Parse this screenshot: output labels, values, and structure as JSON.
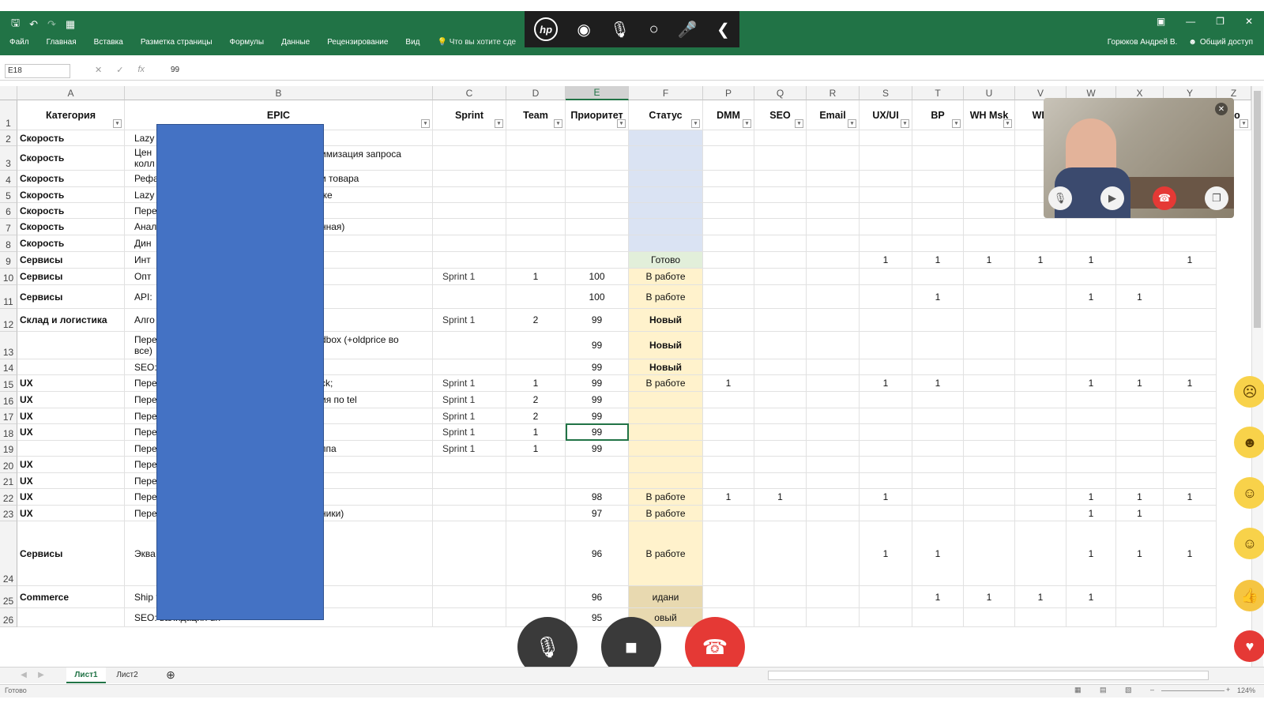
{
  "ribbon": {
    "tabs": [
      "Файл",
      "Главная",
      "Вставка",
      "Разметка страницы",
      "Формулы",
      "Данные",
      "Рецензирование",
      "Вид"
    ],
    "tell_me": "Что вы хотите сде",
    "user": "Горюков Андрей В.",
    "share": "Общий доступ"
  },
  "formula_bar": {
    "name_box": "E18",
    "value": "99"
  },
  "columns": [
    "A",
    "B",
    "C",
    "D",
    "E",
    "F",
    "P",
    "Q",
    "R",
    "S",
    "T",
    "U",
    "V",
    "W",
    "X",
    "Y",
    "Z"
  ],
  "header_row": [
    "Категория",
    "EPIC",
    "Sprint",
    "Team",
    "Приоритет",
    "Статус",
    "DMM",
    "SEO",
    "Email",
    "UX/UI",
    "BP",
    "WH Msk",
    "WH",
    "",
    "",
    "",
    "Co"
  ],
  "rows": [
    {
      "n": "2",
      "cat": "Скорость",
      "epic": "Lazy",
      "epic_right": "",
      "sprint": "",
      "team": "",
      "prio": "",
      "status": "",
      "flags": [
        "",
        "",
        "",
        "",
        "",
        "",
        "",
        "",
        "",
        ""
      ]
    },
    {
      "n": "3",
      "cat": "Скорость",
      "epic": "Цен",
      "epic2": "колл",
      "epic_right": "имизация запроса",
      "sprint": "",
      "team": "",
      "prio": "",
      "status": "",
      "flags": [
        "",
        "",
        "",
        "",
        "",
        "",
        "",
        "",
        "",
        ""
      ]
    },
    {
      "n": "4",
      "cat": "Скорость",
      "epic": "Рефа",
      "epic_right": "и товара",
      "sprint": "",
      "team": "",
      "prio": "",
      "status": "",
      "flags": [
        "",
        "",
        "",
        "",
        "",
        "",
        "",
        "",
        "",
        ""
      ]
    },
    {
      "n": "5",
      "cat": "Скорость",
      "epic": "Lazy",
      "epic_right": "іке",
      "sprint": "",
      "team": "",
      "prio": "",
      "status": "",
      "flags": [
        "",
        "",
        "",
        "",
        "",
        "",
        "",
        "",
        "",
        ""
      ]
    },
    {
      "n": "6",
      "cat": "Скорость",
      "epic": "Пере",
      "epic_right": "",
      "sprint": "",
      "team": "",
      "prio": "",
      "status": "",
      "flags": [
        "",
        "",
        "",
        "",
        "",
        "",
        "",
        "",
        "",
        ""
      ]
    },
    {
      "n": "7",
      "cat": "Скорость",
      "epic": "Анал",
      "epic_right": "нная)",
      "sprint": "",
      "team": "",
      "prio": "",
      "status": "",
      "flags": [
        "",
        "",
        "",
        "",
        "",
        "",
        "",
        "",
        "",
        ""
      ]
    },
    {
      "n": "8",
      "cat": "Скорость",
      "epic": "Дин",
      "epic_right": "",
      "sprint": "",
      "team": "",
      "prio": "",
      "status": "",
      "flags": [
        "",
        "",
        "",
        "",
        "",
        "",
        "",
        "",
        "",
        ""
      ]
    },
    {
      "n": "9",
      "cat": "Сервисы",
      "epic": "Инт",
      "epic_right": "",
      "sprint": "",
      "team": "",
      "prio": "",
      "status": "Готово",
      "flags": [
        "",
        "",
        "",
        "1",
        "1",
        "1",
        "1",
        "1",
        "",
        "1"
      ]
    },
    {
      "n": "10",
      "cat": "Сервисы",
      "epic": "Опт",
      "epic_right": "",
      "sprint": "Sprint 1",
      "team": "1",
      "prio": "100",
      "status": "В работе",
      "flags": [
        "",
        "",
        "",
        "",
        "",
        "",
        "",
        "",
        "",
        ""
      ]
    },
    {
      "n": "11",
      "cat": "Сервисы",
      "epic": "API:",
      "epic_right": "",
      "sprint": "",
      "team": "",
      "prio": "100",
      "status": "В работе",
      "flags": [
        "",
        "",
        "",
        "",
        "1",
        "",
        "",
        "1",
        "1",
        ""
      ]
    },
    {
      "n": "12",
      "cat": "Склад и логистика",
      "epic": "Алго",
      "epic_right": "",
      "sprint": "Sprint 1",
      "team": "2",
      "prio": "99",
      "status": "Новый",
      "flags": [
        "",
        "",
        "",
        "",
        "",
        "",
        "",
        "",
        "",
        ""
      ]
    },
    {
      "n": "13",
      "cat": "",
      "epic": "Пере",
      "epic2": "все)",
      "epic_right": "dbox (+oldprice во",
      "sprint": "",
      "team": "",
      "prio": "99",
      "status": "Новый",
      "flags": [
        "",
        "",
        "",
        "",
        "",
        "",
        "",
        "",
        "",
        ""
      ]
    },
    {
      "n": "14",
      "cat": "",
      "epic": "SEO:",
      "epic_right": "",
      "sprint": "",
      "team": "",
      "prio": "99",
      "status": "Новый",
      "flags": [
        "",
        "",
        "",
        "",
        "",
        "",
        "",
        "",
        "",
        ""
      ]
    },
    {
      "n": "15",
      "cat": "UX",
      "epic": "Пере",
      "epic_right": "ck;",
      "sprint": "Sprint 1",
      "team": "1",
      "prio": "99",
      "status": "В работе",
      "flags": [
        "1",
        "",
        "",
        "1",
        "1",
        "",
        "",
        "1",
        "1",
        "1"
      ]
    },
    {
      "n": "16",
      "cat": "UX",
      "epic": "Пере",
      "epic_right": "ия по tel",
      "sprint": "Sprint 1",
      "team": "2",
      "prio": "99",
      "status": "",
      "flags": [
        "",
        "",
        "",
        "",
        "",
        "",
        "",
        "",
        "",
        ""
      ]
    },
    {
      "n": "17",
      "cat": "UX",
      "epic": "Пере",
      "epic_right": "",
      "sprint": "Sprint 1",
      "team": "2",
      "prio": "99",
      "status": "",
      "flags": [
        "",
        "",
        "",
        "",
        "",
        "",
        "",
        "",
        "",
        ""
      ]
    },
    {
      "n": "18",
      "cat": "UX",
      "epic": "Пере",
      "epic_right": "",
      "sprint": "Sprint 1",
      "team": "1",
      "prio": "99",
      "status": "",
      "flags": [
        "",
        "",
        "",
        "",
        "",
        "",
        "",
        "",
        "",
        ""
      ]
    },
    {
      "n": "19",
      "cat": "",
      "epic": "Пере",
      "epic_right": "ппа",
      "sprint": "Sprint 1",
      "team": "1",
      "prio": "99",
      "status": "",
      "flags": [
        "",
        "",
        "",
        "",
        "",
        "",
        "",
        "",
        "",
        ""
      ]
    },
    {
      "n": "20",
      "cat": "UX",
      "epic": "Пере",
      "epic_right": "",
      "sprint": "",
      "team": "",
      "prio": "",
      "status": "",
      "flags": [
        "",
        "",
        "",
        "",
        "",
        "",
        "",
        "",
        "",
        ""
      ]
    },
    {
      "n": "21",
      "cat": "UX",
      "epic": "Пере",
      "epic_right": "",
      "sprint": "",
      "team": "",
      "prio": "",
      "status": "",
      "flags": [
        "",
        "",
        "",
        "",
        "",
        "",
        "",
        "",
        "",
        ""
      ]
    },
    {
      "n": "22",
      "cat": "UX",
      "epic": "Пере",
      "epic_right": "",
      "sprint": "",
      "team": "",
      "prio": "98",
      "status": "В работе",
      "flags": [
        "1",
        "1",
        "",
        "1",
        "",
        "",
        "",
        "1",
        "1",
        "1"
      ]
    },
    {
      "n": "23",
      "cat": "UX",
      "epic": "Пере",
      "epic_right": "ники)",
      "sprint": "",
      "team": "",
      "prio": "97",
      "status": "В работе",
      "flags": [
        "",
        "",
        "",
        "",
        "",
        "",
        "",
        "1",
        "1",
        ""
      ]
    },
    {
      "n": "24",
      "cat": "Сервисы",
      "epic": "Эква",
      "epic_right": "",
      "sprint": "",
      "team": "",
      "prio": "96",
      "status": "В работе",
      "flags": [
        "",
        "",
        "",
        "1",
        "1",
        "",
        "",
        "1",
        "1",
        "1"
      ]
    },
    {
      "n": "25",
      "cat": "Commerce",
      "epic": "Ship to store: Франчи",
      "epic_right": "",
      "sprint": "",
      "team": "",
      "prio": "96",
      "status": "идани",
      "flags": [
        "",
        "",
        "",
        "",
        "1",
        "1",
        "1",
        "1",
        "",
        ""
      ]
    },
    {
      "n": "26",
      "cat": "",
      "epic": "SEO: валидация url",
      "epic_right": "",
      "sprint": "",
      "team": "",
      "prio": "95",
      "status": "овый",
      "flags": [
        "",
        "",
        "",
        "",
        "",
        "",
        "",
        "",
        "",
        ""
      ]
    }
  ],
  "sheets": [
    "Лист1",
    "Лист2"
  ],
  "status_text": "Готово",
  "zoom": "124%",
  "colors": {
    "ribbon": "#217346",
    "redaction": "#4472c4",
    "status_col": "#fff2cc",
    "status_top": "#dae3f3",
    "done": "#e2efda",
    "hangup": "#e53935"
  }
}
